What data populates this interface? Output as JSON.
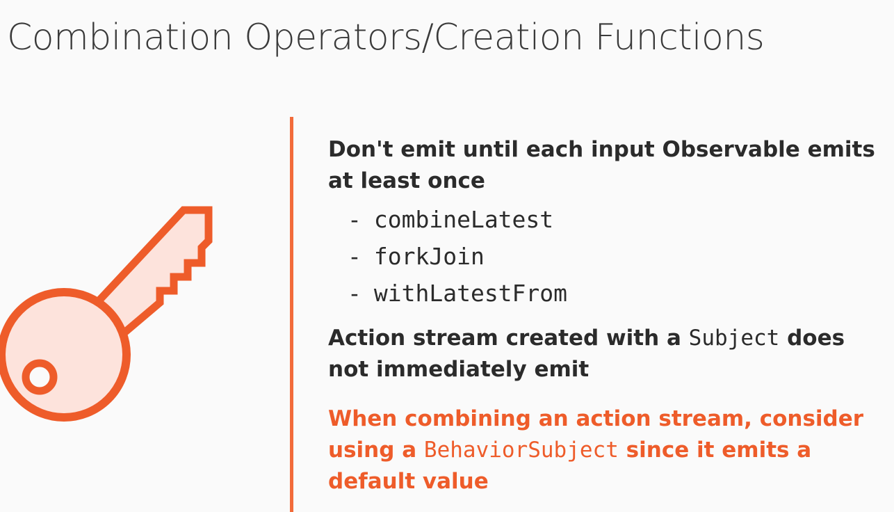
{
  "slide": {
    "title": "Combination Operators/Creation Functions",
    "point1": "Don't emit until each input Observable emits at least once",
    "operators": [
      {
        "dash": "-",
        "name": "combineLatest"
      },
      {
        "dash": "-",
        "name": "forkJoin"
      },
      {
        "dash": "-",
        "name": "withLatestFrom"
      }
    ],
    "point2": {
      "before": "Action stream created with a ",
      "code": "Subject",
      "after": " does not immediately emit"
    },
    "point3": {
      "before": "When combining an action stream, consider using a ",
      "code": "BehaviorSubject",
      "after": " since it emits a default value"
    }
  },
  "colors": {
    "accent": "#ee5c2a",
    "key_fill": "#fde3dc",
    "text": "#2b2b2b",
    "background": "#fafafa"
  },
  "icons": {
    "key": "key-icon"
  }
}
